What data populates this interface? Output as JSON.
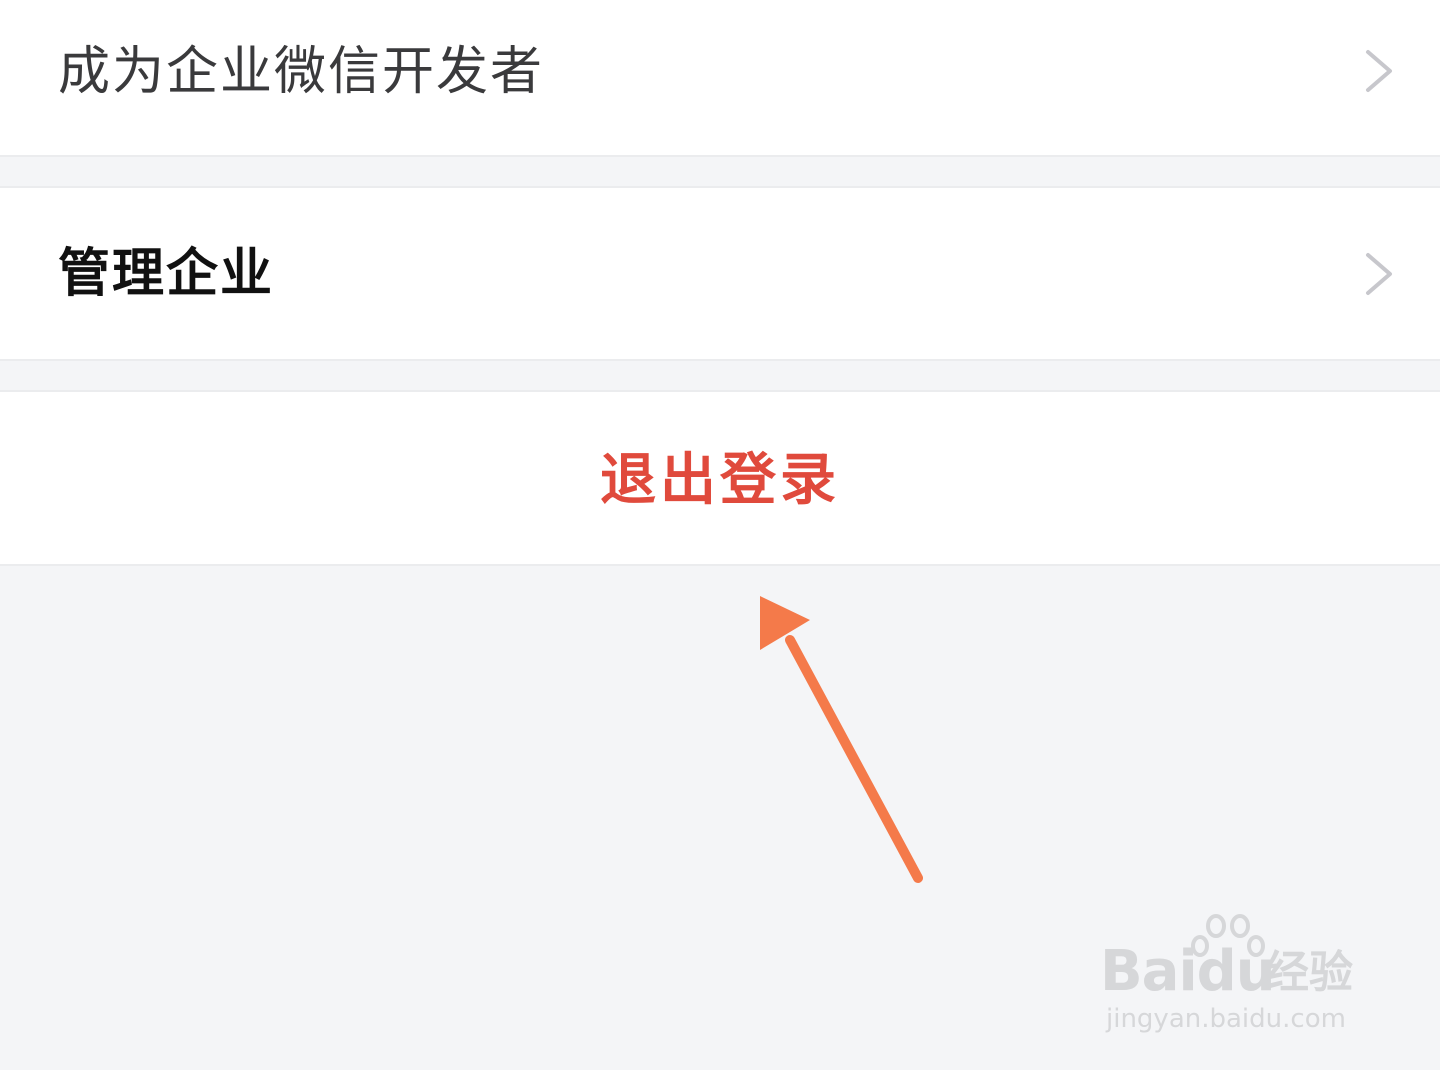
{
  "menu": {
    "items": [
      {
        "label": "成为企业微信开发者",
        "icon": "chevron-right-icon"
      },
      {
        "label": "管理企业",
        "icon": "chevron-right-icon"
      }
    ],
    "logout_label": "退出登录"
  },
  "overlay": {
    "arrow_icon": "pointer-arrow-icon",
    "arrow_color": "#f47a4a"
  },
  "watermark": {
    "brand": "Bai",
    "brand_suffix": "du",
    "product": "经验",
    "url": "jingyan.baidu.com"
  },
  "colors": {
    "background": "#f4f5f7",
    "cell": "#ffffff",
    "logout": "#e04a3c",
    "chevron": "#c7c7cc"
  }
}
